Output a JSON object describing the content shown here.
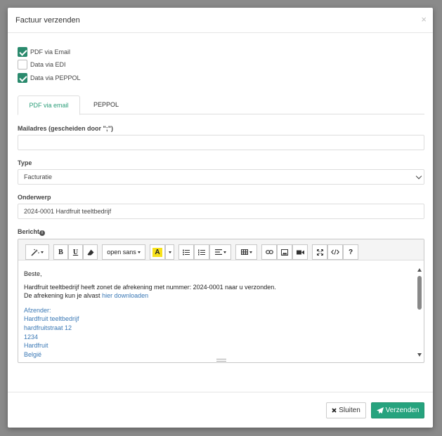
{
  "modal": {
    "title": "Factuur verzenden",
    "close_glyph": "×"
  },
  "options": [
    {
      "label": "PDF via Email",
      "checked": true
    },
    {
      "label": "Data via EDI",
      "checked": false
    },
    {
      "label": "Data via PEPPOL",
      "checked": true
    }
  ],
  "tabs": [
    {
      "label": "PDF via email",
      "active": true
    },
    {
      "label": "PEPPOL",
      "active": false
    }
  ],
  "fields": {
    "email": {
      "label": "Mailadres (gescheiden door \";\")",
      "value": ""
    },
    "type": {
      "label": "Type",
      "value": "Facturatie"
    },
    "subject": {
      "label": "Onderwerp",
      "value": "2024-0001 Hardfruit teeltbedrijf"
    },
    "message": {
      "label": "Bericht",
      "info_glyph": "i"
    }
  },
  "toolbar": {
    "font_name": "open sans",
    "bold": "B",
    "underline": "U",
    "color_letter": "A",
    "help": "?",
    "accent_color": "#f7e11b"
  },
  "editor": {
    "greeting": "Beste,",
    "line1": "Hardfruit teeltbedrijf heeft zonet de afrekening met nummer: 2024-0001 naar u verzonden.",
    "line2_prefix": "De afrekening kun je alvast ",
    "line2_link": "hier downloaden",
    "signature": [
      "Afzender:",
      "Hardfruit teeltbedrijf",
      "hardfruitstraat 12",
      "1234",
      "Hardfruit",
      "België"
    ]
  },
  "footer": {
    "close_label": "Sluiten",
    "send_label": "Verzenden",
    "send_color": "#26a37e"
  }
}
